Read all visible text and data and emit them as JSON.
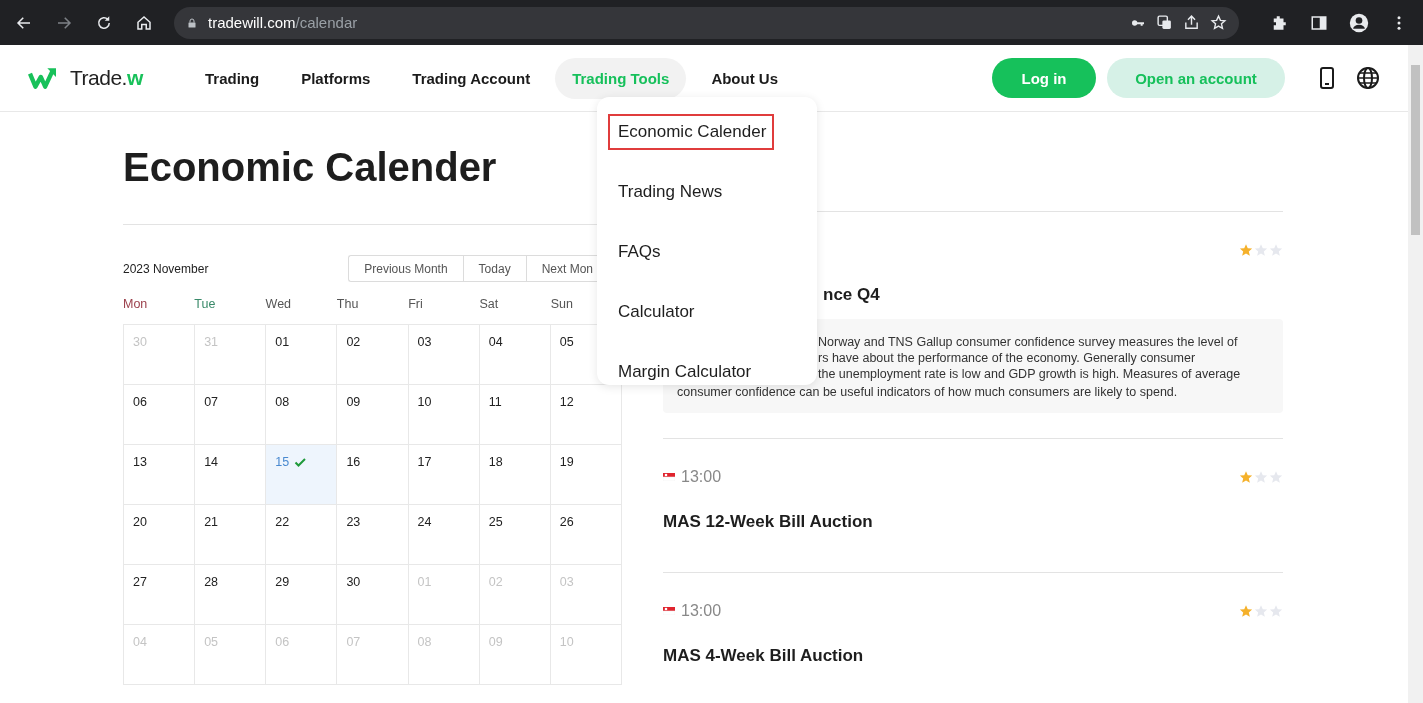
{
  "browser": {
    "url_host": "tradewill.com",
    "url_path": "/calendar"
  },
  "header": {
    "logo": {
      "text": "Trade.",
      "accent": "w"
    },
    "nav": [
      {
        "label": "Trading",
        "selected": false
      },
      {
        "label": "Platforms",
        "selected": false
      },
      {
        "label": "Trading Account",
        "selected": false
      },
      {
        "label": "Trading Tools",
        "selected": true
      },
      {
        "label": "About Us",
        "selected": false
      }
    ],
    "login": "Log in",
    "open_account": "Open an account"
  },
  "dropdown": [
    {
      "label": "Economic Calender",
      "selected": true
    },
    {
      "label": "Trading News",
      "selected": false
    },
    {
      "label": "FAQs",
      "selected": false
    },
    {
      "label": "Calculator",
      "selected": false
    },
    {
      "label": "Margin Calculator",
      "selected": false
    }
  ],
  "title": "Economic Calender",
  "calendar": {
    "month": "2023 November",
    "buttons": [
      "Previous Month",
      "Today",
      "Next Mon"
    ],
    "weekdays": [
      {
        "label": "Mon",
        "color": "#9b3f4b"
      },
      {
        "label": "Tue",
        "color": "#3a8a6a"
      },
      {
        "label": "Wed",
        "color": "#555555"
      },
      {
        "label": "Thu",
        "color": "#555555"
      },
      {
        "label": "Fri",
        "color": "#555555"
      },
      {
        "label": "Sat",
        "color": "#555555"
      },
      {
        "label": "Sun",
        "color": "#555555"
      }
    ],
    "days": [
      {
        "day": "30",
        "muted": true,
        "selected": false
      },
      {
        "day": "31",
        "muted": true,
        "selected": false
      },
      {
        "day": "01",
        "muted": false,
        "selected": false
      },
      {
        "day": "02",
        "muted": false,
        "selected": false
      },
      {
        "day": "03",
        "muted": false,
        "selected": false
      },
      {
        "day": "04",
        "muted": false,
        "selected": false
      },
      {
        "day": "05",
        "muted": false,
        "selected": false
      },
      {
        "day": "06",
        "muted": false,
        "selected": false
      },
      {
        "day": "07",
        "muted": false,
        "selected": false
      },
      {
        "day": "08",
        "muted": false,
        "selected": false
      },
      {
        "day": "09",
        "muted": false,
        "selected": false
      },
      {
        "day": "10",
        "muted": false,
        "selected": false
      },
      {
        "day": "11",
        "muted": false,
        "selected": false
      },
      {
        "day": "12",
        "muted": false,
        "selected": false
      },
      {
        "day": "13",
        "muted": false,
        "selected": false
      },
      {
        "day": "14",
        "muted": false,
        "selected": false
      },
      {
        "day": "15",
        "muted": false,
        "selected": true
      },
      {
        "day": "16",
        "muted": false,
        "selected": false
      },
      {
        "day": "17",
        "muted": false,
        "selected": false
      },
      {
        "day": "18",
        "muted": false,
        "selected": false
      },
      {
        "day": "19",
        "muted": false,
        "selected": false
      },
      {
        "day": "20",
        "muted": false,
        "selected": false
      },
      {
        "day": "21",
        "muted": false,
        "selected": false
      },
      {
        "day": "22",
        "muted": false,
        "selected": false
      },
      {
        "day": "23",
        "muted": false,
        "selected": false
      },
      {
        "day": "24",
        "muted": false,
        "selected": false
      },
      {
        "day": "25",
        "muted": false,
        "selected": false
      },
      {
        "day": "26",
        "muted": false,
        "selected": false
      },
      {
        "day": "27",
        "muted": false,
        "selected": false
      },
      {
        "day": "28",
        "muted": false,
        "selected": false
      },
      {
        "day": "29",
        "muted": false,
        "selected": false
      },
      {
        "day": "30",
        "muted": false,
        "selected": false
      },
      {
        "day": "01",
        "muted": true,
        "selected": false
      },
      {
        "day": "02",
        "muted": true,
        "selected": false
      },
      {
        "day": "03",
        "muted": true,
        "selected": false
      },
      {
        "day": "04",
        "muted": true,
        "selected": false
      },
      {
        "day": "05",
        "muted": true,
        "selected": false
      },
      {
        "day": "06",
        "muted": true,
        "selected": false
      },
      {
        "day": "07",
        "muted": true,
        "selected": false
      },
      {
        "day": "08",
        "muted": true,
        "selected": false
      },
      {
        "day": "09",
        "muted": true,
        "selected": false
      },
      {
        "day": "10",
        "muted": true,
        "selected": false
      }
    ]
  },
  "events": [
    {
      "stars": 1,
      "title": "nce Q4",
      "title_covered": true,
      "description": [
        {
          "text": "Norway and TNS Gallup consumer confidence survey measures the level of",
          "covered": true
        },
        {
          "text": "rs have about the performance of the economy. Generally consumer",
          "covered": true
        },
        {
          "text": "the unemployment rate is low and GDP growth is high. Measures of average",
          "covered": true
        },
        {
          "text": "consumer confidence can be useful indicators of how much consumers are likely to spend.",
          "covered": false
        }
      ]
    },
    {
      "time": "13:00",
      "stars": 1,
      "title": "MAS 12-Week Bill Auction"
    },
    {
      "time": "13:00",
      "stars": 1,
      "title": "MAS 4-Week Bill Auction"
    }
  ]
}
